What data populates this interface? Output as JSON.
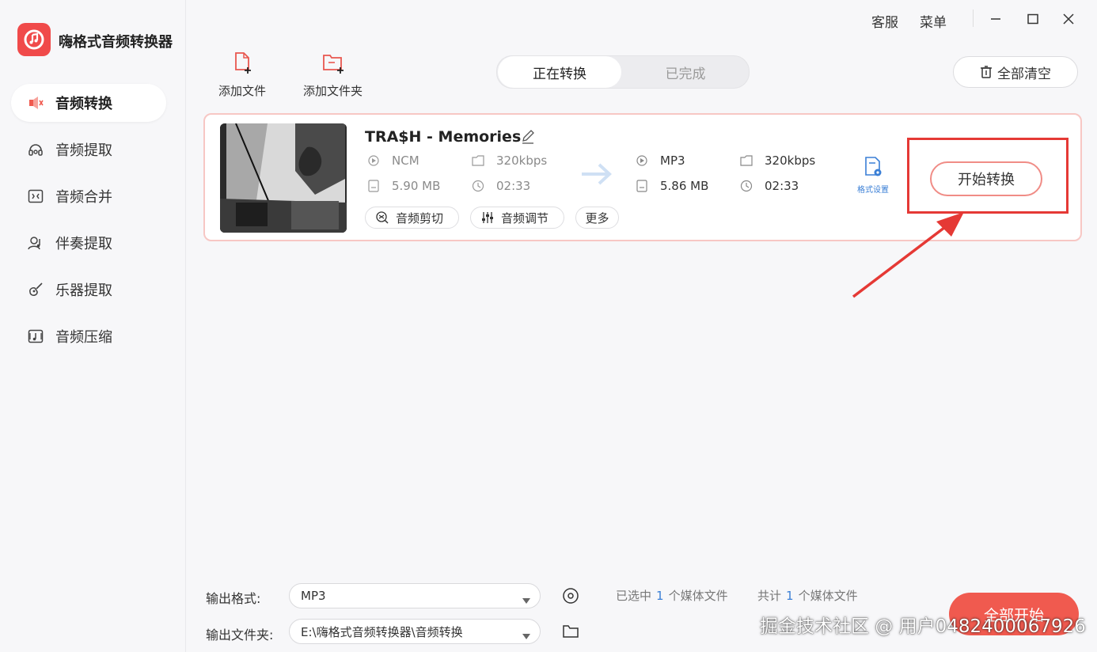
{
  "app": {
    "title": "嗨格式音频转换器"
  },
  "topbar": {
    "service": "客服",
    "menu": "菜单"
  },
  "sidebar": {
    "items": [
      {
        "label": "音频转换",
        "icon": "speaker-convert-icon",
        "active": true
      },
      {
        "label": "音频提取",
        "icon": "headset-extract-icon",
        "active": false
      },
      {
        "label": "音频合并",
        "icon": "merge-icon",
        "active": false
      },
      {
        "label": "伴奏提取",
        "icon": "accompaniment-icon",
        "active": false
      },
      {
        "label": "乐器提取",
        "icon": "guitar-icon",
        "active": false
      },
      {
        "label": "音频压缩",
        "icon": "compress-icon",
        "active": false
      }
    ]
  },
  "toolbar": {
    "add_file": "添加文件",
    "add_folder": "添加文件夹",
    "tabs": [
      {
        "label": "正在转换",
        "active": true
      },
      {
        "label": "已完成",
        "active": false
      }
    ],
    "clear_all": "全部清空"
  },
  "file": {
    "title": "TRA$H - Memories",
    "source": {
      "format": "NCM",
      "bitrate": "320kbps",
      "size": "5.90 MB",
      "duration": "02:33"
    },
    "target": {
      "format": "MP3",
      "bitrate": "320kbps",
      "size": "5.86 MB",
      "duration": "02:33"
    },
    "format_settings": "格式设置",
    "actions": {
      "cut": "音频剪切",
      "adjust": "音频调节",
      "more": "更多"
    },
    "start": "开始转换"
  },
  "bottom": {
    "output_format_label": "输出格式:",
    "output_format_value": "MP3",
    "output_folder_label": "输出文件夹:",
    "output_folder_value": "E:\\嗨格式音频转换器\\音频转换",
    "selected_prefix": "已选中",
    "selected_count": "1",
    "selected_suffix": "个媒体文件",
    "total_prefix": "共计",
    "total_count": "1",
    "total_suffix": "个媒体文件",
    "start_all": "全部开始"
  },
  "watermark": "掘金技术社区 @ 用户0482400067926",
  "colors": {
    "accent": "#f05a4f",
    "highlight": "#e53935",
    "link": "#3a7fd6"
  }
}
